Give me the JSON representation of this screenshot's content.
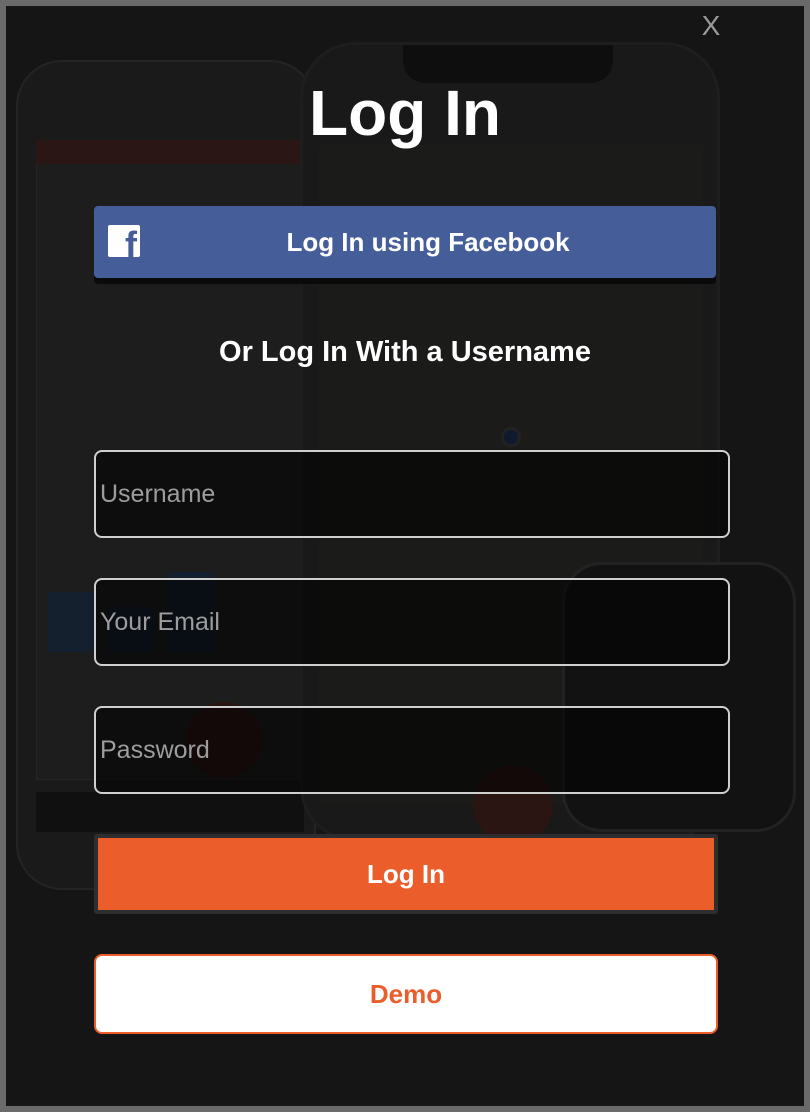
{
  "modal": {
    "close_label": "X",
    "title": "Log In",
    "facebook_button_label": "Log In using Facebook",
    "facebook_icon": "facebook-icon",
    "subtitle": "Or Log In With a Username",
    "fields": {
      "username_placeholder": "Username",
      "email_placeholder": "Your Email",
      "password_placeholder": "Password"
    },
    "login_button_label": "Log In",
    "demo_button_label": "Demo"
  },
  "colors": {
    "accent": "#eb5e2b",
    "facebook": "#455e99",
    "modal_background": "#151515"
  }
}
